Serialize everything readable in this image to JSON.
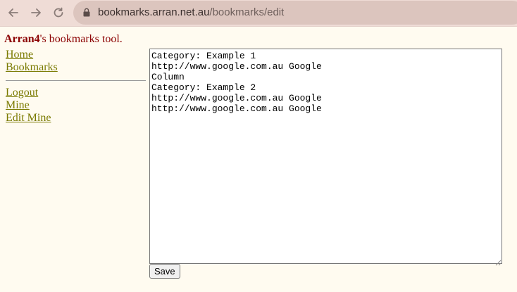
{
  "browser": {
    "url_host": "bookmarks.arran.net.au",
    "url_path": "/bookmarks/edit"
  },
  "header": {
    "username": "Arran4",
    "suffix": "'s bookmarks tool."
  },
  "sidebar": {
    "top_links": [
      {
        "label": "Home"
      },
      {
        "label": "Bookmarks"
      }
    ],
    "bottom_links": [
      {
        "label": "Logout"
      },
      {
        "label": "Mine"
      },
      {
        "label": "Edit Mine"
      }
    ]
  },
  "editor": {
    "content": "Category: Example 1\nhttp://www.google.com.au Google\nColumn\nCategory: Example 2\nhttp://www.google.com.au Google\nhttp://www.google.com.au Google",
    "save_label": "Save"
  },
  "colors": {
    "header_text": "#8b0000",
    "link": "#7a7a00",
    "page_background": "#fffbf0"
  }
}
